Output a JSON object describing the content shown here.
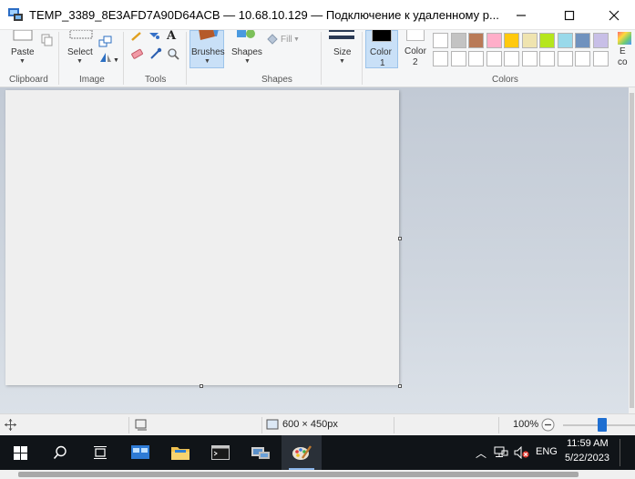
{
  "window": {
    "title": "TEMP_3389_8E3AFD7A90D64ACB — 10.68.10.129 — Подключение к удаленному р..."
  },
  "ribbon": {
    "clipboard": {
      "paste_label": "Paste",
      "group_label": "Clipboard"
    },
    "image": {
      "select_label": "Select",
      "group_label": "Image"
    },
    "tools": {
      "group_label": "Tools"
    },
    "brushes": {
      "label": "Brushes"
    },
    "shapes": {
      "label": "Shapes",
      "fill_label": "Fill",
      "group_label": "Shapes"
    },
    "size": {
      "label": "Size"
    },
    "color1": {
      "label_line1": "Color",
      "label_line2": "1",
      "value": "#000000"
    },
    "color2": {
      "label_line1": "Color",
      "label_line2": "2",
      "value": "#ffffff"
    },
    "colors": {
      "group_label": "Colors",
      "row1": [
        "#ffffff",
        "#c3c3c3",
        "#b97a57",
        "#ffaec9",
        "#ffc90e",
        "#efe4b0",
        "#b5e61d",
        "#99d9ea",
        "#7092be",
        "#c8bfe7"
      ],
      "row2": [
        "#ffffff",
        "#ffffff",
        "#ffffff",
        "#ffffff",
        "#ffffff",
        "#ffffff",
        "#ffffff",
        "#ffffff",
        "#ffffff",
        "#ffffff"
      ]
    },
    "edit_colors": {
      "label_line1": "E",
      "label_line2": "co"
    }
  },
  "statusbar": {
    "canvas_size": "600 × 450px",
    "zoom": "100%",
    "zoom_slider_value": 0.7
  },
  "taskbar": {
    "tray": {
      "lang": "ENG",
      "time": "11:59 AM",
      "date": "5/22/2023"
    }
  }
}
